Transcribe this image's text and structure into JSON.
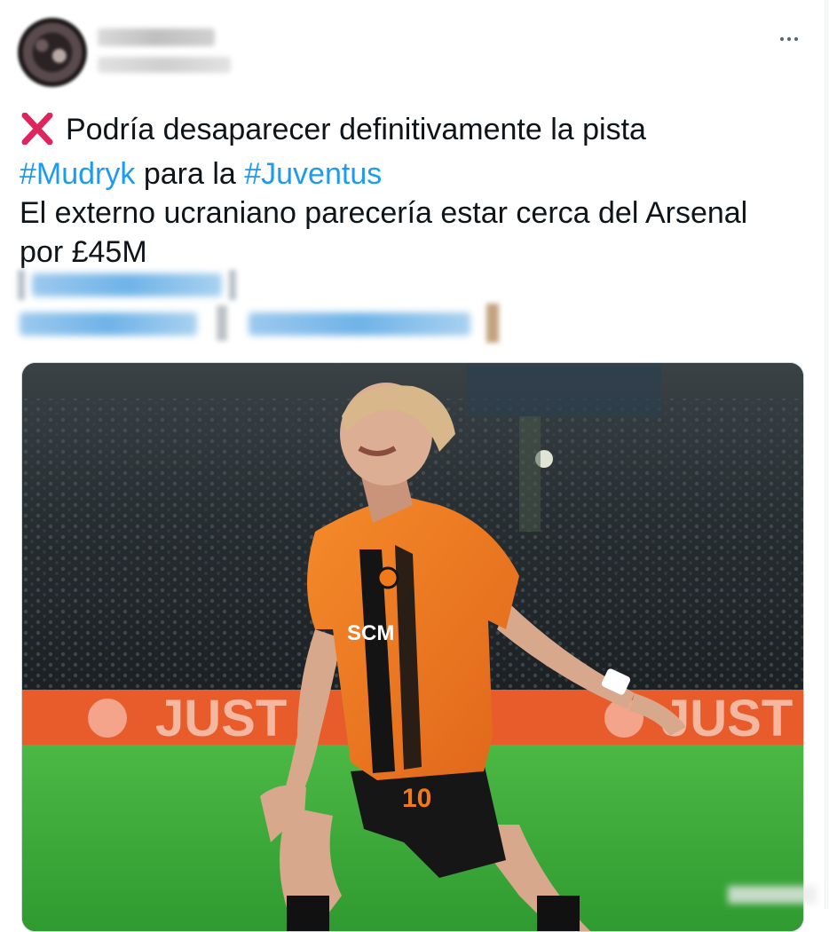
{
  "tweet": {
    "text": {
      "line1": "Podría desaparecer definitivamente la pista",
      "hashtag1": "#Mudryk",
      "line2_mid": " para la ",
      "hashtag2": "#Juventus",
      "line3": "El externo ucraniano parecería estar cerca del Arsenal",
      "line4": "por £45M"
    },
    "icons": {
      "status": "cross-mark-icon",
      "more": "more-options-icon"
    },
    "media": {
      "board_text_left": "JUST",
      "board_text_right": "JUST",
      "shirt_sponsor": "SCM",
      "shorts_number": "10"
    },
    "colors": {
      "hashtag": "#1d9bf0",
      "cross": "#e0245e",
      "jersey": "#f07a1a",
      "board": "#e85c2c",
      "pitch": "#3fae3a"
    }
  }
}
